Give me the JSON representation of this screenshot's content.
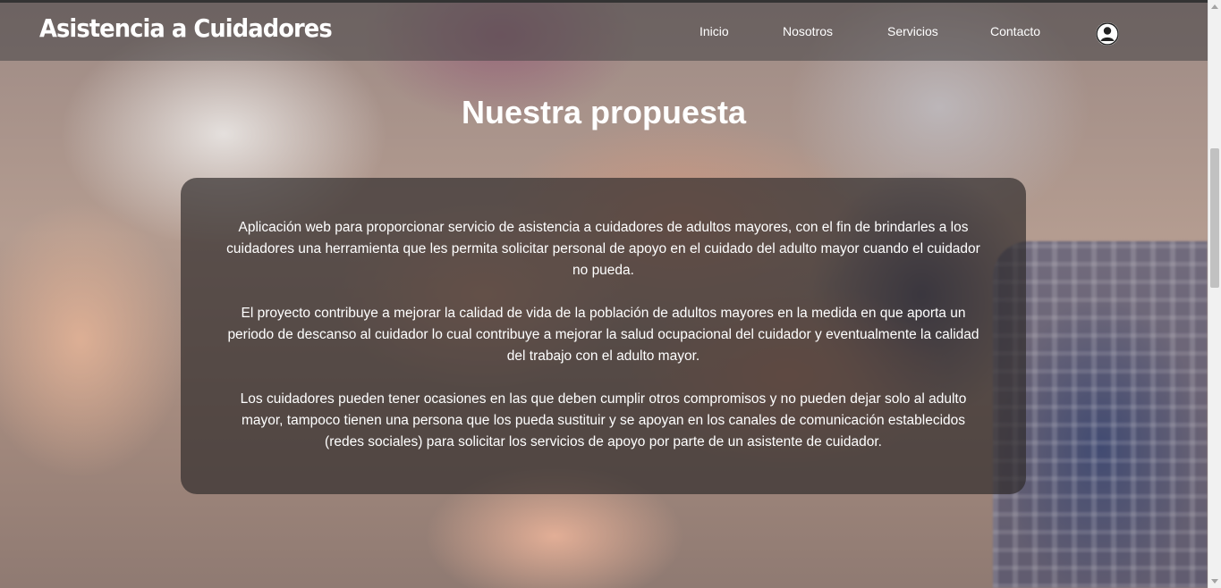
{
  "header": {
    "brand": "Asistencia a Cuidadores",
    "nav": [
      {
        "label": "Inicio"
      },
      {
        "label": "Nosotros"
      },
      {
        "label": "Servicios"
      },
      {
        "label": "Contacto"
      }
    ],
    "user_icon": "user-circle-icon"
  },
  "main": {
    "title": "Nuestra propuesta",
    "paragraphs": [
      "Aplicación web para proporcionar servicio de asistencia a cuidadores de adultos mayores, con el fin de brindarles a los cuidadores una herramienta que les permita solicitar personal de apoyo en el cuidado del adulto mayor cuando el cuidador no pueda.",
      "El proyecto contribuye a mejorar la calidad de vida de la población de adultos mayores en la medida en que aporta un periodo de descanso al cuidador lo cual contribuye a mejorar la salud ocupacional del cuidador y eventualmente la calidad del trabajo con el adulto mayor.",
      "Los cuidadores pueden tener ocasiones en las que deben cumplir otros compromisos y no pueden dejar solo al adulto mayor, tampoco tienen una persona que los pueda sustituir y se apoyan en los canales de comunicación establecidos (redes sociales) para solicitar los servicios de apoyo por parte de un asistente de cuidador."
    ]
  },
  "colors": {
    "text": "#ffffff",
    "navbar_bg": "rgba(70,68,70,0.55)",
    "card_bg": "rgba(45,42,42,0.68)"
  }
}
